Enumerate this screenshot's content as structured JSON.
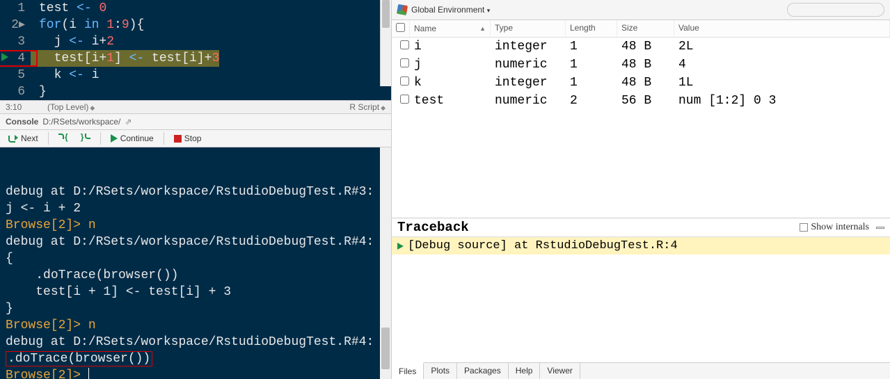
{
  "editor": {
    "lines": [
      {
        "num": "1",
        "tokens": [
          {
            "t": "test ",
            "c": ""
          },
          {
            "t": "<-",
            "c": "tok-kw"
          },
          {
            "t": " ",
            "c": ""
          },
          {
            "t": "0",
            "c": "tok-num"
          }
        ]
      },
      {
        "num": "2",
        "suffix": "▸",
        "tokens": [
          {
            "t": "for",
            "c": "tok-kw"
          },
          {
            "t": "(i ",
            "c": ""
          },
          {
            "t": "in",
            "c": "tok-kw"
          },
          {
            "t": " ",
            "c": ""
          },
          {
            "t": "1",
            "c": "tok-num"
          },
          {
            "t": ":",
            "c": ""
          },
          {
            "t": "9",
            "c": "tok-num"
          },
          {
            "t": "){",
            "c": ""
          }
        ]
      },
      {
        "num": "3",
        "tokens": [
          {
            "t": "  j ",
            "c": ""
          },
          {
            "t": "<-",
            "c": "tok-kw"
          },
          {
            "t": " i+",
            "c": ""
          },
          {
            "t": "2",
            "c": "tok-num"
          }
        ]
      },
      {
        "num": "4",
        "active": true,
        "hl": true,
        "tokens": [
          {
            "t": "  test[i+",
            "c": ""
          },
          {
            "t": "1",
            "c": "tok-num"
          },
          {
            "t": "] ",
            "c": ""
          },
          {
            "t": "<-",
            "c": "tok-kw"
          },
          {
            "t": " test[i]+",
            "c": ""
          },
          {
            "t": "3",
            "c": "tok-num"
          }
        ]
      },
      {
        "num": "5",
        "tokens": [
          {
            "t": "  k ",
            "c": ""
          },
          {
            "t": "<-",
            "c": "tok-kw"
          },
          {
            "t": " i",
            "c": ""
          }
        ]
      },
      {
        "num": "6",
        "tokens": [
          {
            "t": "}",
            "c": ""
          }
        ]
      }
    ],
    "status": {
      "pos": "3:10",
      "scope": "(Top Level)",
      "lang": "R Script"
    }
  },
  "console": {
    "title": "Console",
    "path": "D:/RSets/workspace/",
    "toolbar": {
      "next": "Next",
      "continue": "Continue",
      "stop": "Stop"
    },
    "lines": [
      {
        "t": "debug at D:/RSets/workspace/RstudioDebugTest.R#3: j <- i + 2",
        "c": ""
      },
      {
        "t": "Browse[2]> n",
        "c": "c-warn"
      },
      {
        "t": "debug at D:/RSets/workspace/RstudioDebugTest.R#4: {",
        "c": ""
      },
      {
        "t": "    .doTrace(browser())",
        "c": ""
      },
      {
        "t": "    test[i + 1] <- test[i] + 3",
        "c": ""
      },
      {
        "t": "}",
        "c": ""
      },
      {
        "t": "Browse[2]> n",
        "c": "c-warn"
      },
      {
        "t": "debug at D:/RSets/workspace/RstudioDebugTest.R#4: ",
        "c": "",
        "boxed": ".doTrace(browser())"
      },
      {
        "t": "Browse[2]> ",
        "c": "c-warn",
        "cursor": true
      }
    ]
  },
  "env": {
    "scope": "Global Environment",
    "search_placeholder": "",
    "cols": {
      "name": "Name",
      "type": "Type",
      "length": "Length",
      "size": "Size",
      "value": "Value"
    },
    "rows": [
      {
        "name": "i",
        "type": "integer",
        "length": "1",
        "size": "48 B",
        "value": "2L"
      },
      {
        "name": "j",
        "type": "numeric",
        "length": "1",
        "size": "48 B",
        "value": "4"
      },
      {
        "name": "k",
        "type": "integer",
        "length": "1",
        "size": "48 B",
        "value": "1L"
      },
      {
        "name": "test",
        "type": "numeric",
        "length": "2",
        "size": "56 B",
        "value": "num [1:2] 0 3"
      }
    ]
  },
  "traceback": {
    "title": "Traceback",
    "show_internals": "Show internals",
    "frame": "[Debug source] at RstudioDebugTest.R:4"
  },
  "tabs": [
    "Files",
    "Plots",
    "Packages",
    "Help",
    "Viewer"
  ]
}
